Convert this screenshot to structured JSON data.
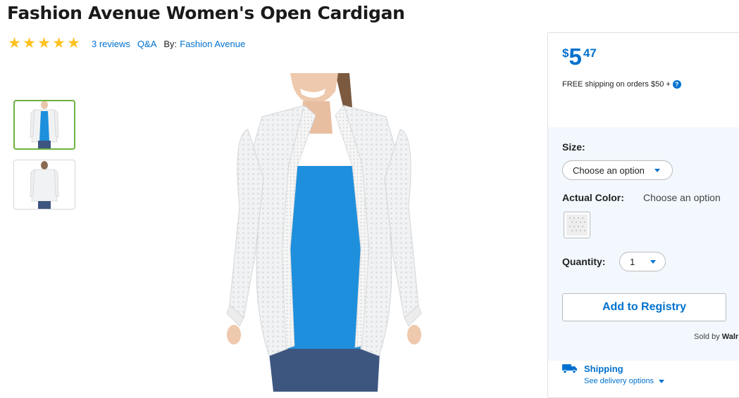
{
  "product": {
    "title": "Fashion Avenue Women's Open Cardigan",
    "rating": 5,
    "reviews_label": "3 reviews",
    "qa_label": "Q&A",
    "by_label": "By:",
    "brand": "Fashion Avenue"
  },
  "gallery": {
    "thumbnails": [
      {
        "view": "front",
        "selected": true
      },
      {
        "view": "back",
        "selected": false
      }
    ]
  },
  "purchase": {
    "currency": "$",
    "price_dollars": "5",
    "price_cents": "47",
    "shipping_note": "FREE shipping on orders $50 +",
    "size_label": "Size:",
    "size_value": "Choose an option",
    "color_label": "Actual Color:",
    "color_value": "Choose an option",
    "quantity_label": "Quantity:",
    "quantity_value": "1",
    "registry_button": "Add to Registry",
    "sold_by_prefix": "Sold by",
    "sold_by_name": "Walr",
    "shipping_title": "Shipping",
    "delivery_link": "See delivery options"
  },
  "colors": {
    "accent": "#0071ce",
    "star": "#ffc220",
    "selected_border": "#6db33f",
    "panel_bg": "#f2f8fd",
    "top_color": "#1e8fdc",
    "cardigan": "#f1f2f3",
    "jeans": "#3d5680"
  },
  "icons": {
    "star": "star-icon",
    "help": "question-circle-icon",
    "caret": "chevron-down-icon",
    "truck": "truck-icon"
  }
}
